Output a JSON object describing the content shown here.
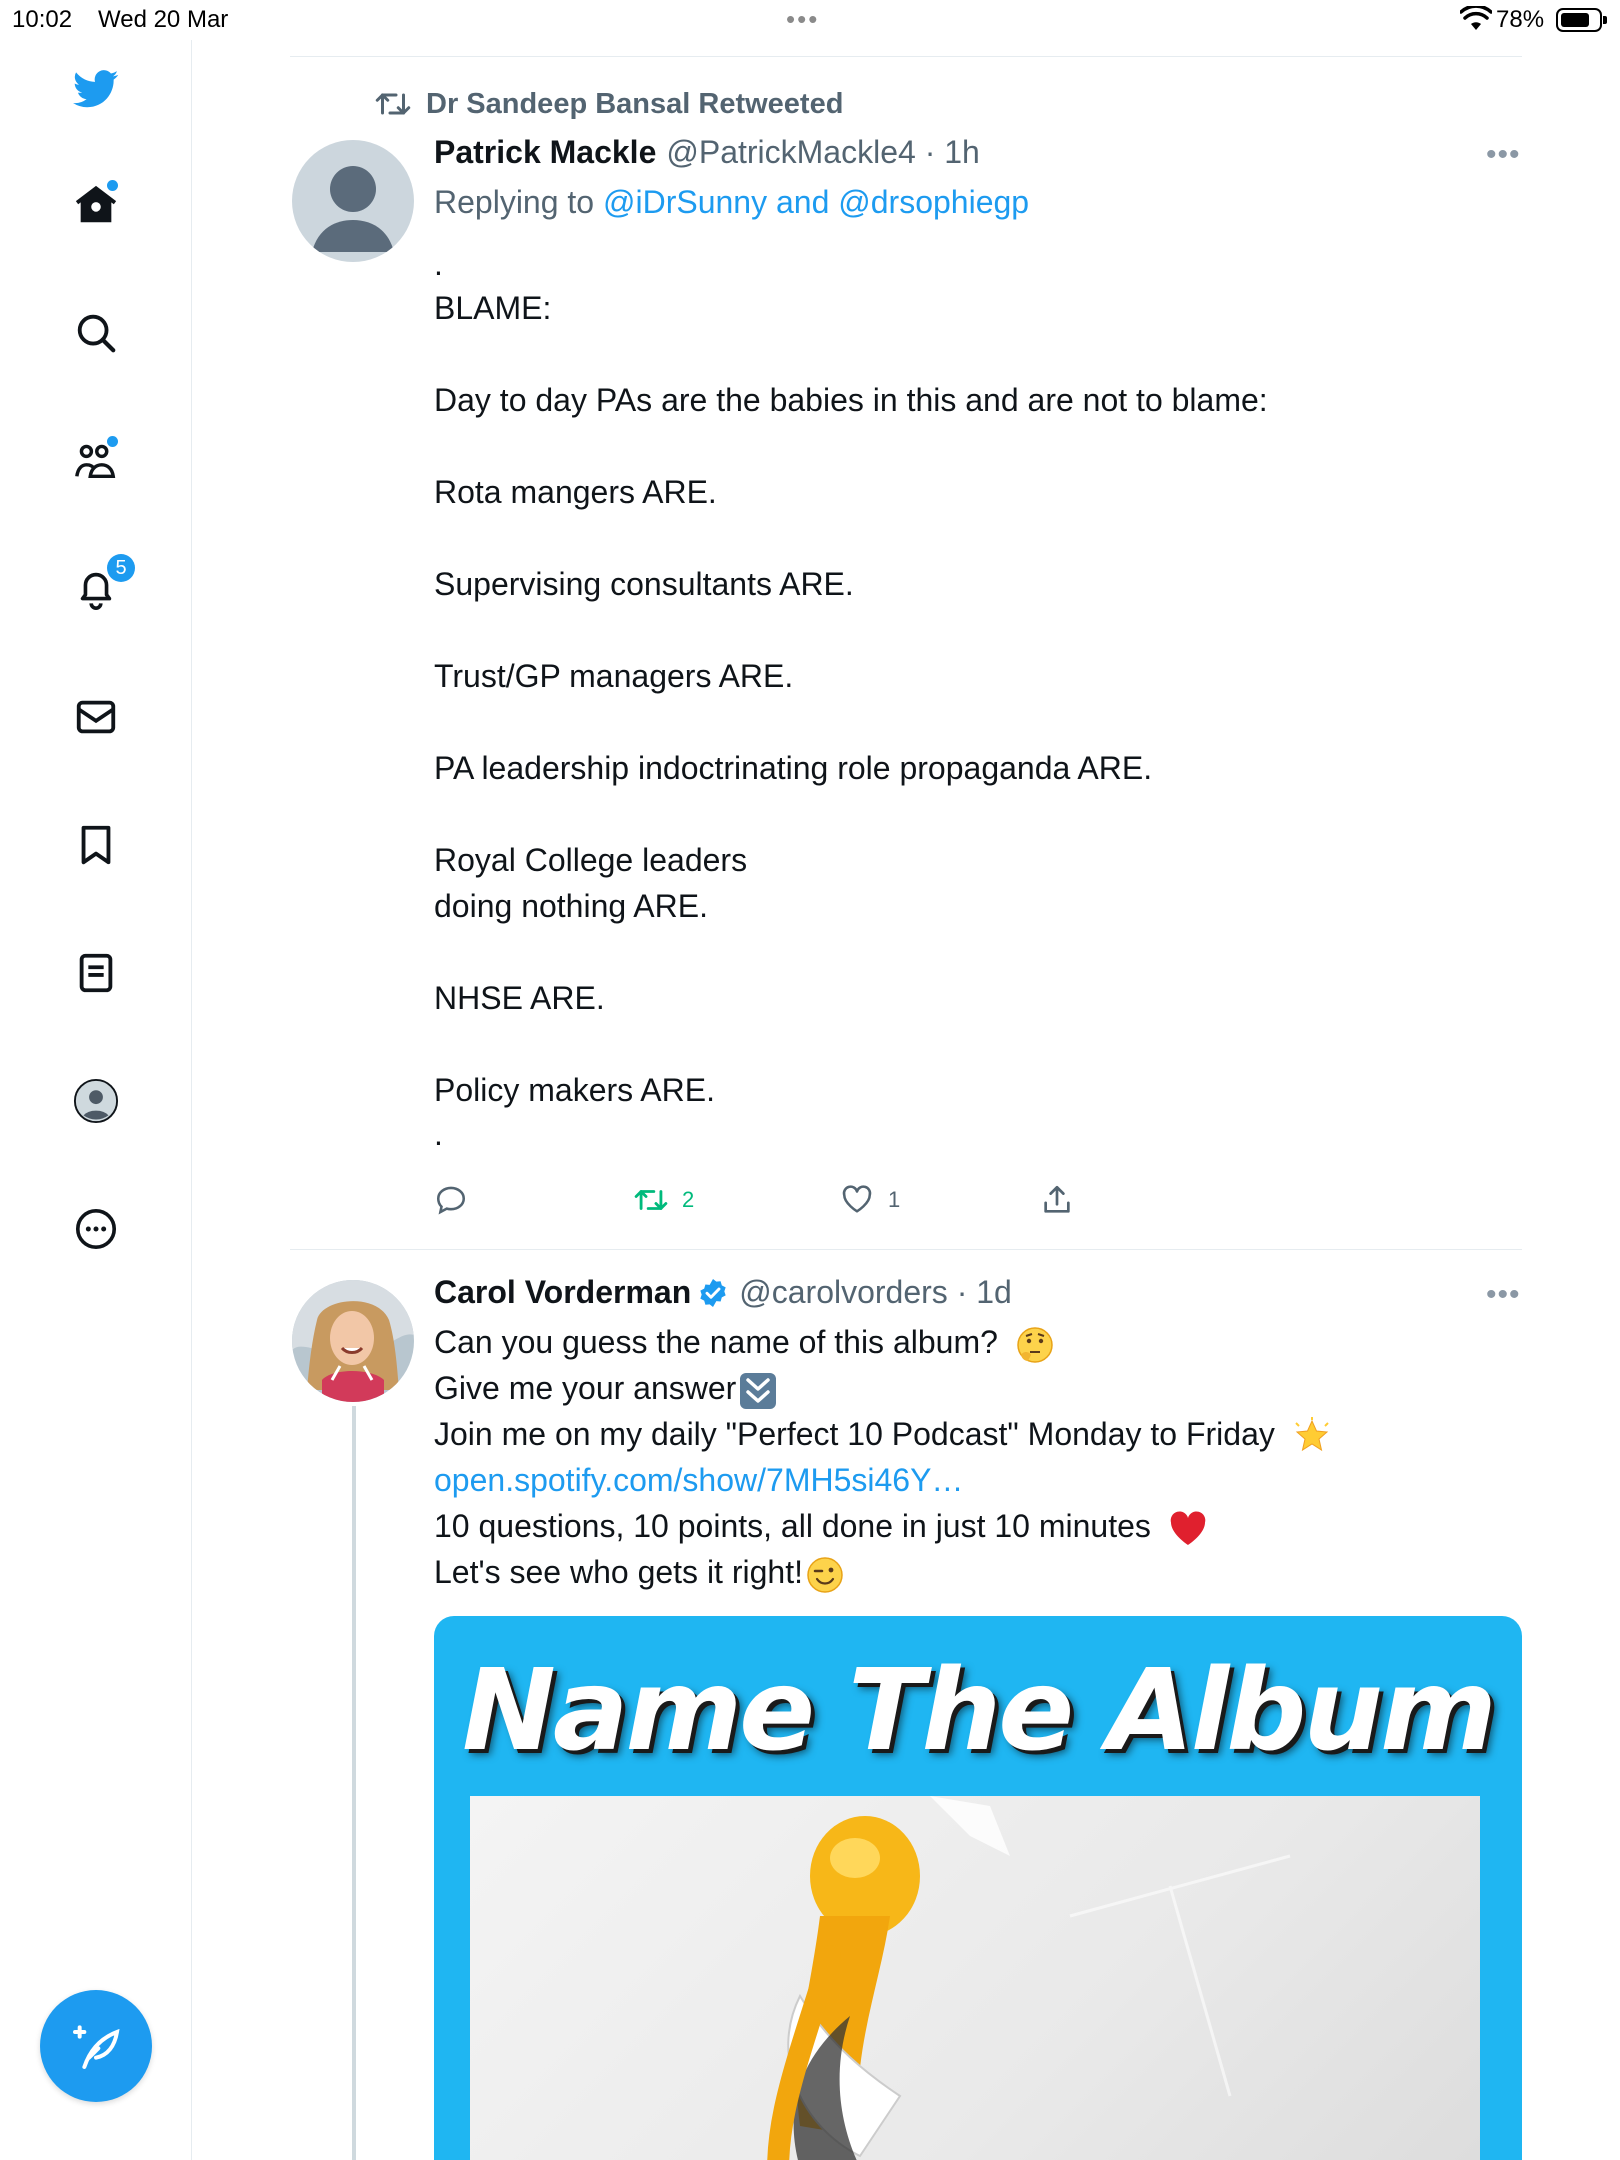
{
  "status_bar": {
    "time": "10:02",
    "date": "Wed 20 Mar",
    "battery_percent": "78%",
    "battery_level": 0.78
  },
  "sidebar": {
    "items": [
      {
        "name": "home",
        "icon": "home-icon"
      },
      {
        "name": "search",
        "icon": "search-icon"
      },
      {
        "name": "communities",
        "icon": "communities-icon"
      },
      {
        "name": "notifications",
        "icon": "bell-icon",
        "badge": "5"
      },
      {
        "name": "messages",
        "icon": "mail-icon"
      },
      {
        "name": "bookmarks",
        "icon": "bookmark-icon"
      },
      {
        "name": "lists",
        "icon": "list-icon"
      },
      {
        "name": "profile",
        "icon": "profile-icon"
      },
      {
        "name": "more",
        "icon": "more-circle-icon"
      }
    ],
    "compose_icon": "compose-feather-icon"
  },
  "colors": {
    "accent": "#1d9bf0",
    "retweet_green": "#00ba7c",
    "secondary_text": "#536471",
    "media_background": "#1fb6f2"
  },
  "tweet1": {
    "retweet_context": "Dr Sandeep Bansal Retweeted",
    "author_name": "Patrick Mackle",
    "handle_time": "@PatrickMackle4 · 1h",
    "replying_prefix": "Replying to",
    "replying_to": "@iDrSunny and @drsophiegp",
    "lines": [
      ".",
      "BLAME:",
      "Day to day PAs are the babies in this and are not to blame:",
      "Rota mangers ARE.",
      "Supervising consultants ARE.",
      "Trust/GP managers ARE.",
      "PA leadership indoctrinating role propaganda ARE.",
      "Royal College leaders",
      "doing nothing ARE.",
      "NHSE ARE.",
      "Policy makers ARE.",
      "."
    ],
    "retweet_count": "2",
    "like_count": "1"
  },
  "tweet2": {
    "author_name": "Carol Vorderman",
    "handle_time": "@carolvorders · 1d",
    "lines": [
      "Can you guess the name of this album?",
      "Give me your answer",
      "Join me on my daily \"Perfect 10 Podcast\" Monday to Friday",
      "open.spotify.com/show/7MH5si46Y…",
      "10 questions, 10 points, all done in just 10 minutes",
      "Let's see who gets it right!"
    ],
    "media_title": "Name The Album"
  }
}
